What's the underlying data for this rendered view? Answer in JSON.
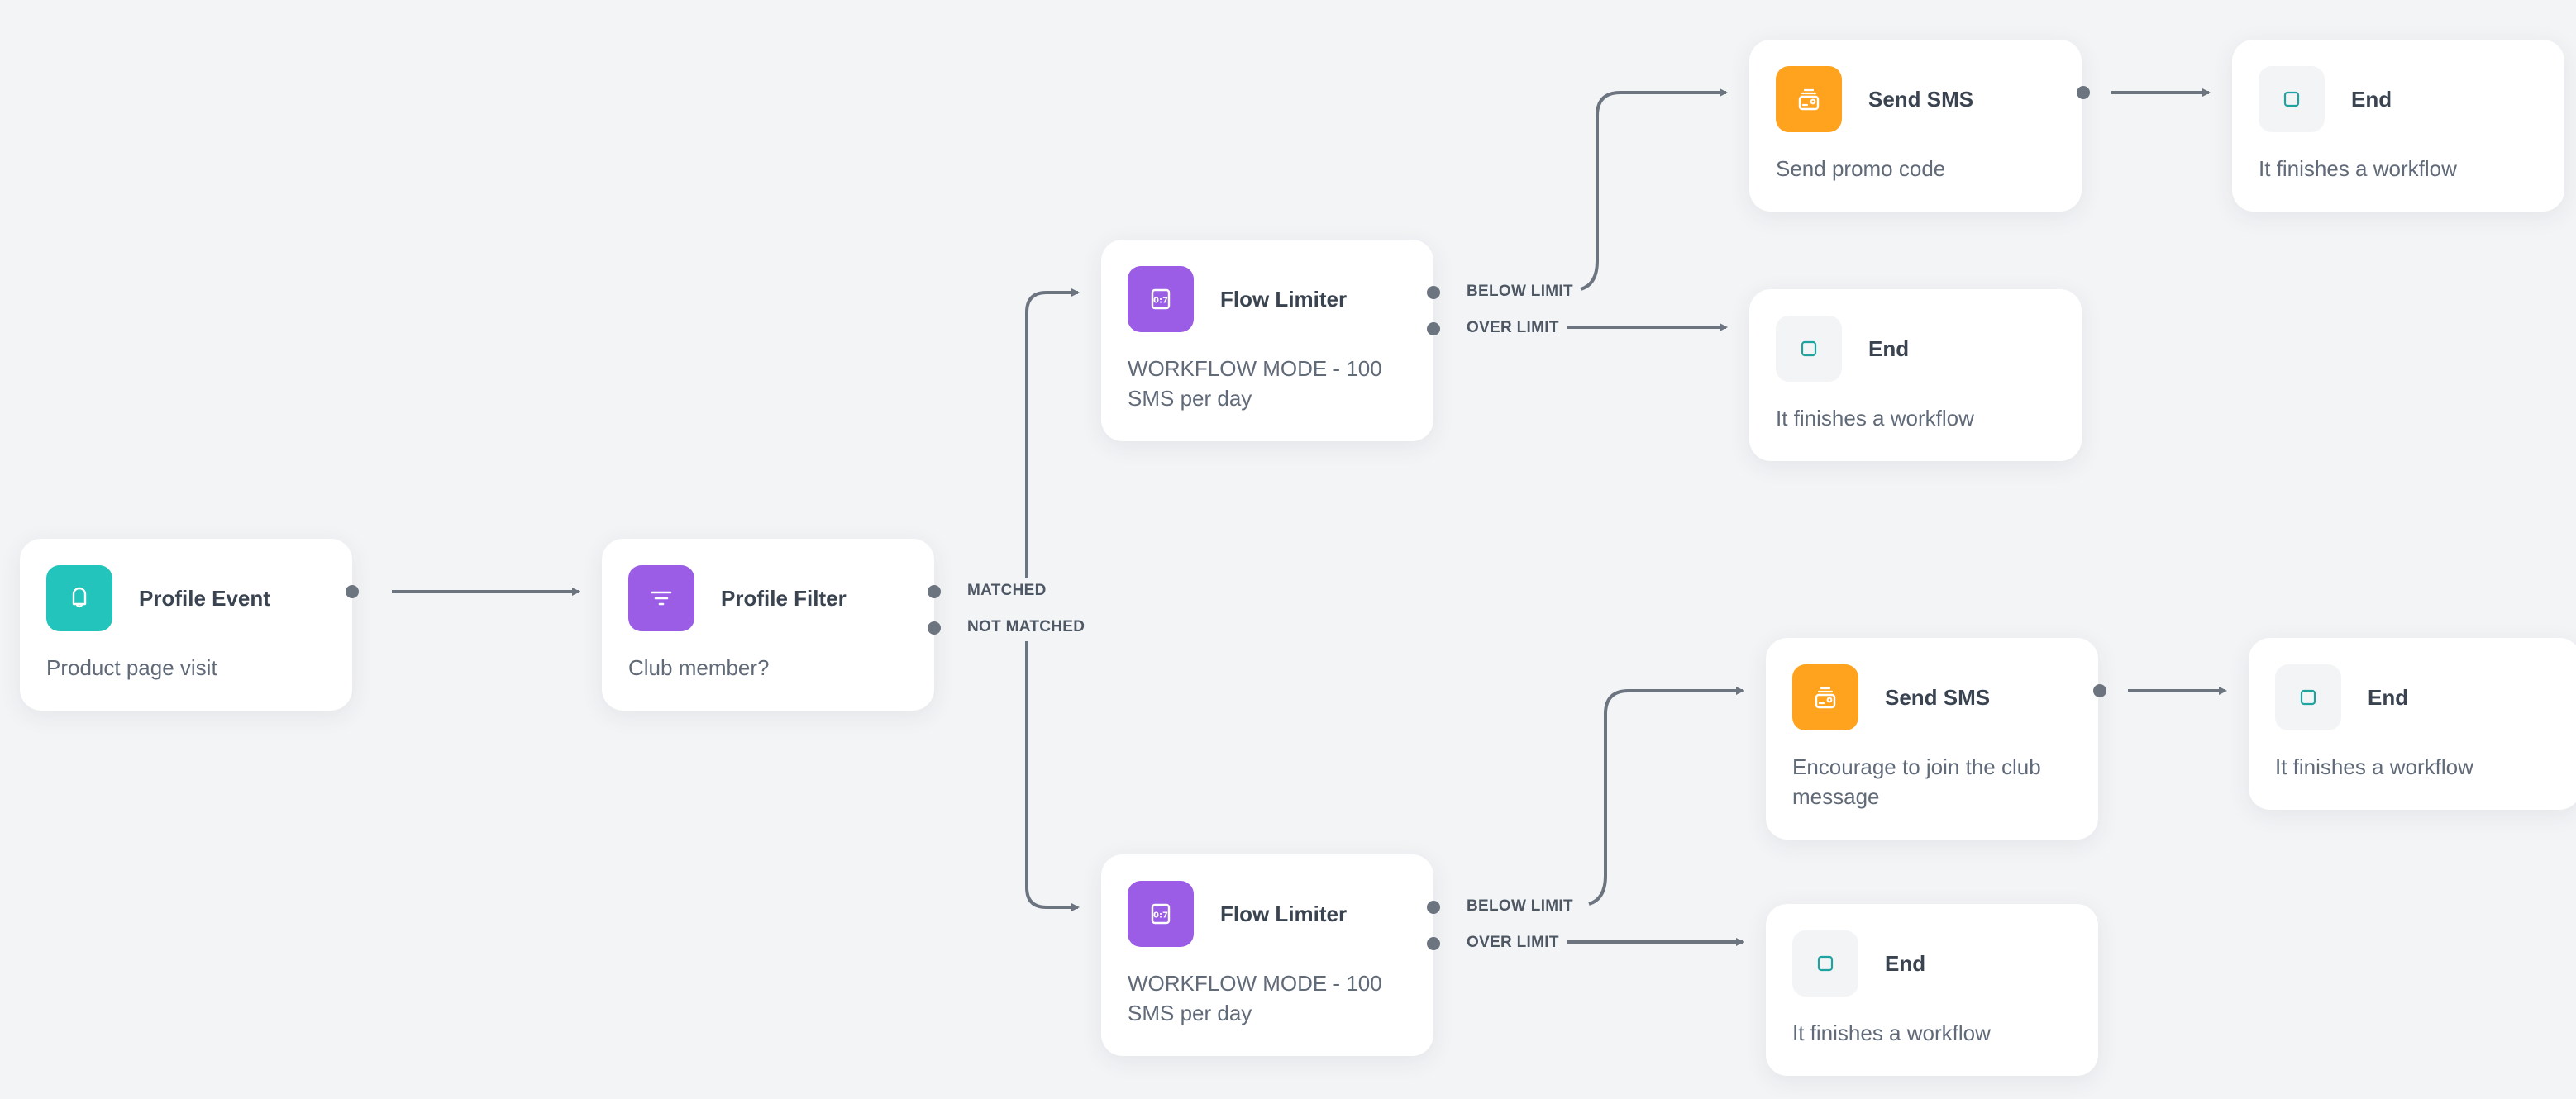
{
  "colors": {
    "canvas": "#f3f4f6",
    "trigger": "#22c4bc",
    "logic": "#9b5de5",
    "sms": "#ffa31f",
    "end_bg": "#f2f4f6",
    "end_stroke": "#1fa39f",
    "connector": "#6c7480"
  },
  "nodes": [
    {
      "id": "profile-event",
      "title": "Profile Event",
      "description": "Product page visit",
      "icon": "bell-icon",
      "kind": "trigger"
    },
    {
      "id": "profile-filter",
      "title": "Profile Filter",
      "description": "Club member?",
      "icon": "filter-icon",
      "kind": "logic",
      "ports": [
        "MATCHED",
        "NOT MATCHED"
      ]
    },
    {
      "id": "flow-limiter-top",
      "title": "Flow Limiter",
      "description": "WORKFLOW MODE - 100 SMS per day",
      "icon": "flow-limiter-icon",
      "kind": "logic",
      "ports": [
        "BELOW LIMIT",
        "OVER LIMIT"
      ]
    },
    {
      "id": "flow-limiter-bottom",
      "title": "Flow Limiter",
      "description": "WORKFLOW MODE - 100 SMS per day",
      "icon": "flow-limiter-icon",
      "kind": "logic",
      "ports": [
        "BELOW LIMIT",
        "OVER LIMIT"
      ]
    },
    {
      "id": "send-sms-top",
      "title": "Send SMS",
      "description": "Send promo code",
      "icon": "sms-icon",
      "kind": "sms"
    },
    {
      "id": "end-top-right",
      "title": "End",
      "description": "It finishes a workflow",
      "icon": "end-icon",
      "kind": "end"
    },
    {
      "id": "end-top-over",
      "title": "End",
      "description": "It finishes a workflow",
      "icon": "end-icon",
      "kind": "end"
    },
    {
      "id": "send-sms-bottom",
      "title": "Send SMS",
      "description": "Encourage to join the club message",
      "icon": "sms-icon",
      "kind": "sms"
    },
    {
      "id": "end-bottom-right",
      "title": "End",
      "description": "It finishes a workflow",
      "icon": "end-icon",
      "kind": "end"
    },
    {
      "id": "end-bottom-over",
      "title": "End",
      "description": "It finishes a workflow",
      "icon": "end-icon",
      "kind": "end"
    }
  ],
  "edges": [
    {
      "from": "profile-event",
      "to": "profile-filter",
      "label": ""
    },
    {
      "from": "profile-filter",
      "to": "flow-limiter-top",
      "label": "MATCHED"
    },
    {
      "from": "profile-filter",
      "to": "flow-limiter-bottom",
      "label": "NOT MATCHED"
    },
    {
      "from": "flow-limiter-top",
      "to": "send-sms-top",
      "label": "BELOW LIMIT"
    },
    {
      "from": "flow-limiter-top",
      "to": "end-top-over",
      "label": "OVER LIMIT"
    },
    {
      "from": "send-sms-top",
      "to": "end-top-right",
      "label": ""
    },
    {
      "from": "flow-limiter-bottom",
      "to": "send-sms-bottom",
      "label": "BELOW LIMIT"
    },
    {
      "from": "flow-limiter-bottom",
      "to": "end-bottom-over",
      "label": "OVER LIMIT"
    },
    {
      "from": "send-sms-bottom",
      "to": "end-bottom-right",
      "label": ""
    }
  ]
}
